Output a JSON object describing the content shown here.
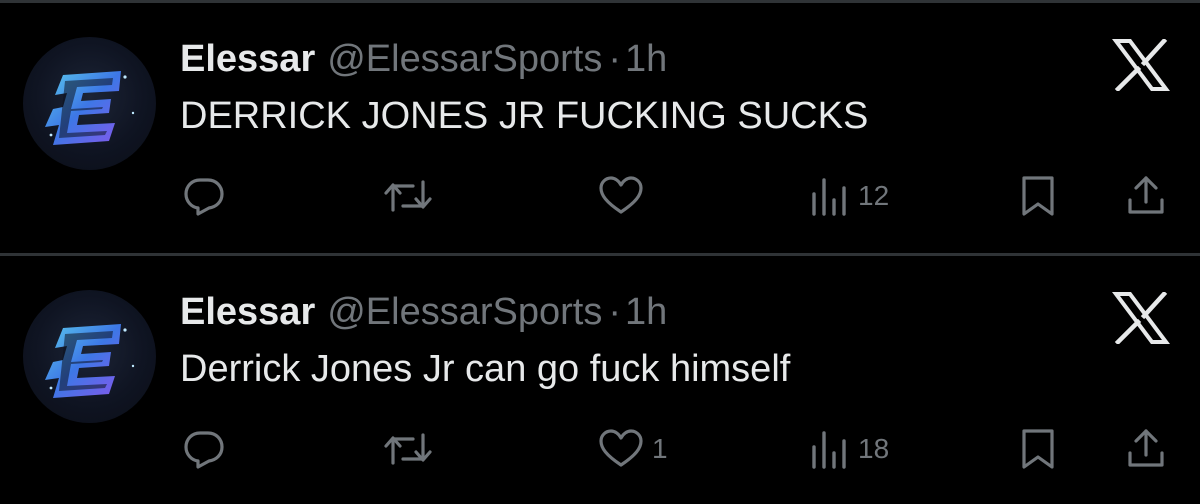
{
  "tweets": [
    {
      "author_name": "Elessar",
      "handle": "@ElessarSports",
      "separator": "·",
      "time": "1h",
      "text": "DERRICK JONES JR FUCKING SUCKS",
      "likes": "",
      "views": "12"
    },
    {
      "author_name": "Elessar",
      "handle": "@ElessarSports",
      "separator": "·",
      "time": "1h",
      "text": "Derrick Jones Jr can go fuck himself",
      "likes": "1",
      "views": "18"
    }
  ],
  "icons": {
    "reply": "reply-icon",
    "retweet": "retweet-icon",
    "like": "heart-icon",
    "views": "views-chart-icon",
    "bookmark": "bookmark-icon",
    "share": "share-icon",
    "platform": "x-logo-icon",
    "avatar": "elessar-e-logo"
  },
  "colors": {
    "background": "#000000",
    "primary_text": "#e7e9ea",
    "secondary_text": "#71767b",
    "divider": "#2f3336",
    "avatar_accent_blue": "#3fa9f5",
    "avatar_accent_purple": "#8a5cf6"
  }
}
